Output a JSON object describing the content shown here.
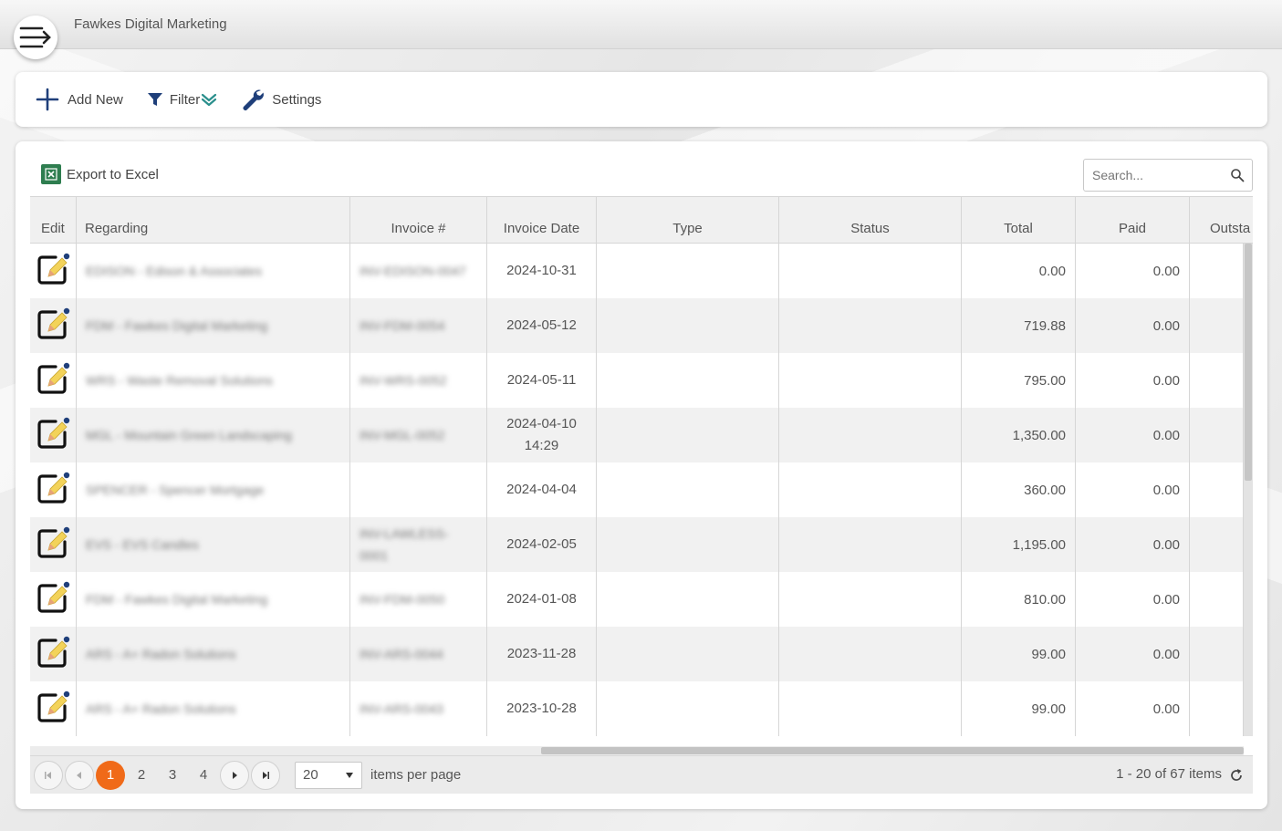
{
  "app": {
    "title": "Fawkes Digital Marketing"
  },
  "toolbar": {
    "add_new": "Add New",
    "filter": "Filter",
    "settings": "Settings"
  },
  "panel": {
    "export_label": "Export to Excel",
    "search_placeholder": "Search..."
  },
  "grid": {
    "columns": [
      "Edit",
      "Regarding",
      "Invoice #",
      "Invoice Date",
      "Type",
      "Status",
      "Total",
      "Paid",
      "Outsta"
    ],
    "rows": [
      {
        "regarding": "EDISON - Edison & Associates",
        "invoice": "INV-EDISON-0047",
        "date": "2024-10-31",
        "date2": "",
        "type": "",
        "status": "",
        "total": "0.00",
        "paid": "0.00"
      },
      {
        "regarding": "FDM - Fawkes Digital Marketing",
        "invoice": "INV-FDM-0054",
        "date": "2024-05-12",
        "date2": "",
        "type": "",
        "status": "",
        "total": "719.88",
        "paid": "0.00"
      },
      {
        "regarding": "WRS - Waste Removal Solutions",
        "invoice": "INV-WRS-0052",
        "date": "2024-05-11",
        "date2": "",
        "type": "",
        "status": "",
        "total": "795.00",
        "paid": "0.00"
      },
      {
        "regarding": "MGL - Mountain Green Landscaping",
        "invoice": "INV-MGL-0052",
        "date": "2024-04-10",
        "date2": "14:29",
        "type": "",
        "status": "",
        "total": "1,350.00",
        "paid": "0.00"
      },
      {
        "regarding": "SPENCER - Spencer Mortgage",
        "invoice": "",
        "date": "2024-04-04",
        "date2": "",
        "type": "",
        "status": "",
        "total": "360.00",
        "paid": "0.00"
      },
      {
        "regarding": "EVS - EVS Candles",
        "invoice": "INV-LAWLESS-",
        "invoice2": "0001",
        "date": "2024-02-05",
        "date2": "",
        "type": "",
        "status": "",
        "total": "1,195.00",
        "paid": "0.00"
      },
      {
        "regarding": "FDM - Fawkes Digital Marketing",
        "invoice": "INV-FDM-0050",
        "date": "2024-01-08",
        "date2": "",
        "type": "",
        "status": "",
        "total": "810.00",
        "paid": "0.00"
      },
      {
        "regarding": "ARS - A+ Radon Solutions",
        "invoice": "INV-ARS-0044",
        "date": "2023-11-28",
        "date2": "",
        "type": "",
        "status": "",
        "total": "99.00",
        "paid": "0.00"
      },
      {
        "regarding": "ARS - A+ Radon Solutions",
        "invoice": "INV-ARS-0043",
        "date": "2023-10-28",
        "date2": "",
        "type": "",
        "status": "",
        "total": "99.00",
        "paid": "0.00"
      }
    ]
  },
  "pager": {
    "pages": [
      "1",
      "2",
      "3",
      "4"
    ],
    "current": "1",
    "page_size": "20",
    "items_per_page": "items per page",
    "info": "1 - 20 of 67 items"
  },
  "colors": {
    "accent": "#f06a19",
    "icon_blue": "#1f3f7a",
    "excel_green": "#2e7d4f",
    "pencil_yellow": "#f3d35a"
  }
}
